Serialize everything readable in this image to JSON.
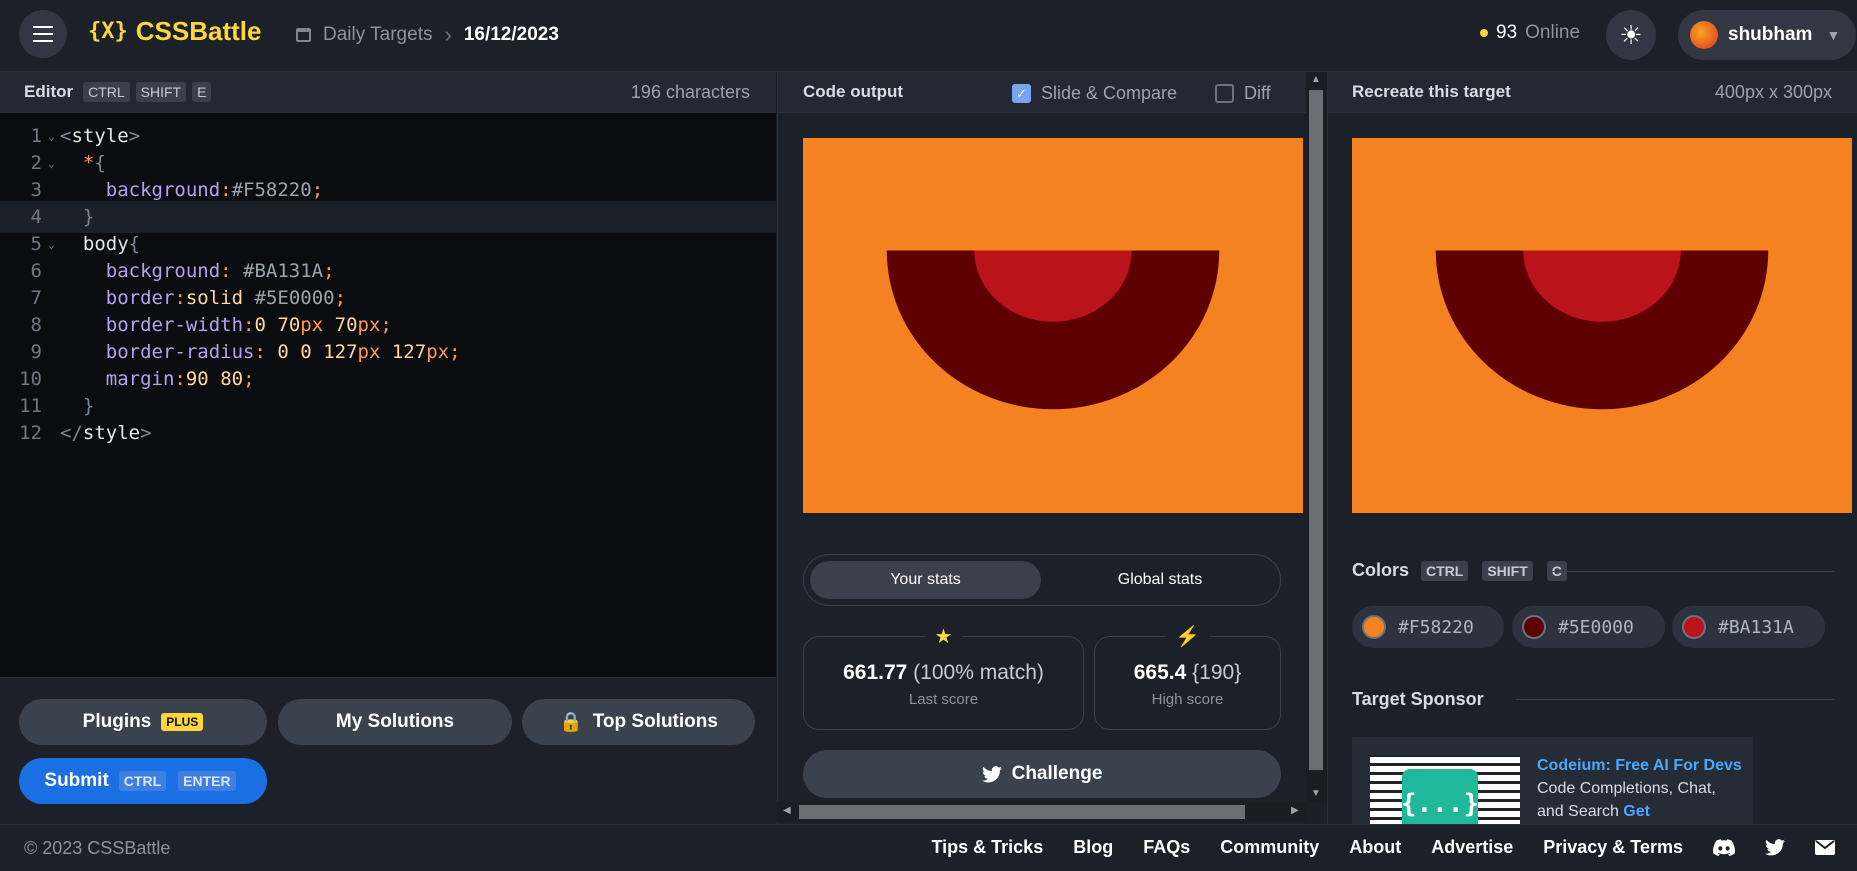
{
  "header": {
    "logo_mark": "{X}",
    "logo_text": "CSSBattle",
    "breadcrumb_section": "Daily Targets",
    "breadcrumb_date": "16/12/2023",
    "online_count": "93",
    "online_label": "Online",
    "username": "shubham"
  },
  "editor": {
    "title": "Editor",
    "shortcut": [
      "CTRL",
      "SHIFT",
      "E"
    ],
    "char_count": "196 characters",
    "lines": [
      {
        "n": "1",
        "fold": true
      },
      {
        "n": "2",
        "fold": true
      },
      {
        "n": "3",
        "fold": false
      },
      {
        "n": "4",
        "fold": false
      },
      {
        "n": "5",
        "fold": true
      },
      {
        "n": "6",
        "fold": false
      },
      {
        "n": "7",
        "fold": false
      },
      {
        "n": "8",
        "fold": false
      },
      {
        "n": "9",
        "fold": false
      },
      {
        "n": "10",
        "fold": false
      },
      {
        "n": "11",
        "fold": false
      },
      {
        "n": "12",
        "fold": false
      }
    ],
    "code": {
      "l1_tag": "style",
      "l2_sel": "*",
      "l3_prop": "background",
      "l3_val": "#F58220",
      "l5_sel": "body",
      "l6_prop": "background",
      "l6_val": "#BA131A",
      "l7_prop": "border",
      "l7_val": "solid",
      "l7_hex": "#5E0000",
      "l8_prop": "border-width",
      "l8_v1": "0",
      "l8_v2": "70",
      "l8_u2": "px",
      "l8_v3": "70",
      "l8_u3": "px",
      "l9_prop": "border-radius",
      "l9_v1": "0",
      "l9_v2": "0",
      "l9_v3": "127",
      "l9_u3": "px",
      "l9_v4": "127",
      "l9_u4": "px",
      "l10_prop": "margin",
      "l10_v1": "90",
      "l10_v2": "80",
      "l12_tag": "style"
    },
    "buttons": {
      "plugins": "Plugins",
      "plus_badge": "PLUS",
      "my_solutions": "My Solutions",
      "top_solutions": "Top Solutions",
      "submit": "Submit",
      "submit_shortcut": [
        "CTRL",
        "ENTER"
      ]
    }
  },
  "output": {
    "title": "Code output",
    "slide_compare_label": "Slide & Compare",
    "slide_compare_checked": true,
    "diff_label": "Diff",
    "diff_checked": false,
    "tabs": [
      "Your stats",
      "Global stats"
    ],
    "last_score_value": "661.77",
    "last_score_match": "(100% match)",
    "last_score_label": "Last score",
    "high_score_value": "665.4",
    "high_score_chars": "{190}",
    "high_score_label": "High score",
    "challenge_label": "Challenge"
  },
  "target": {
    "title": "Recreate this target",
    "dimensions": "400px x 300px",
    "colors_title": "Colors",
    "colors_shortcut": [
      "CTRL",
      "SHIFT",
      "C"
    ],
    "colors": [
      "#F58220",
      "#5E0000",
      "#BA131A"
    ],
    "sponsor_title": "Target Sponsor",
    "sponsor_image_text": "{...}",
    "sponsor_link": "Codeium: Free AI For Devs",
    "sponsor_body": "Code Completions, Chat, and Search",
    "sponsor_cta": "Get"
  },
  "footer": {
    "copyright": "© 2023 CSSBattle",
    "links": [
      "Tips & Tricks",
      "Blog",
      "FAQs",
      "Community",
      "About",
      "Advertise",
      "Privacy & Terms"
    ]
  }
}
